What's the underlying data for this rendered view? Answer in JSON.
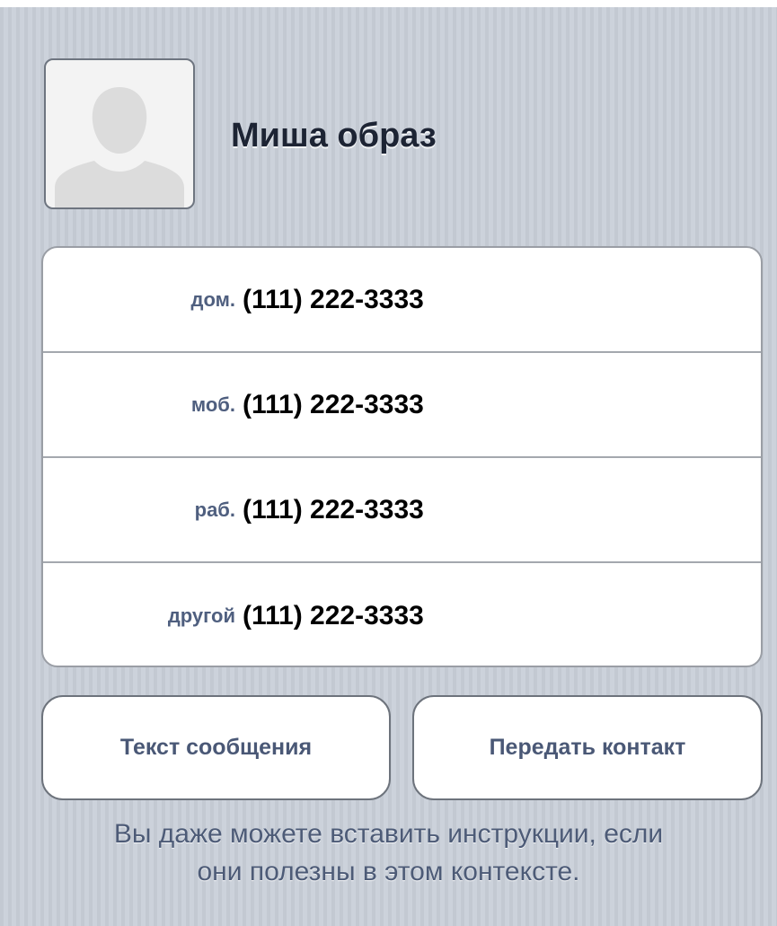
{
  "contact": {
    "name": "Миша образ",
    "avatar_icon": "person-placeholder-icon"
  },
  "phones": [
    {
      "label": "дом.",
      "value": "(111) 222-3333"
    },
    {
      "label": "моб.",
      "value": "(111) 222-3333"
    },
    {
      "label": "раб.",
      "value": "(111) 222-3333"
    },
    {
      "label": "другой",
      "value": "(111) 222-3333"
    }
  ],
  "actions": {
    "text_message": "Текст сообщения",
    "share_contact": "Передать контакт"
  },
  "instructions": {
    "line1": "Вы даже можете вставить инструкции, если",
    "line2": "они полезны в этом контексте."
  },
  "colors": {
    "background": "#c6ccd5",
    "name_text": "#1d2434",
    "label_text": "#4f5f7f",
    "button_text": "#4a5876"
  }
}
